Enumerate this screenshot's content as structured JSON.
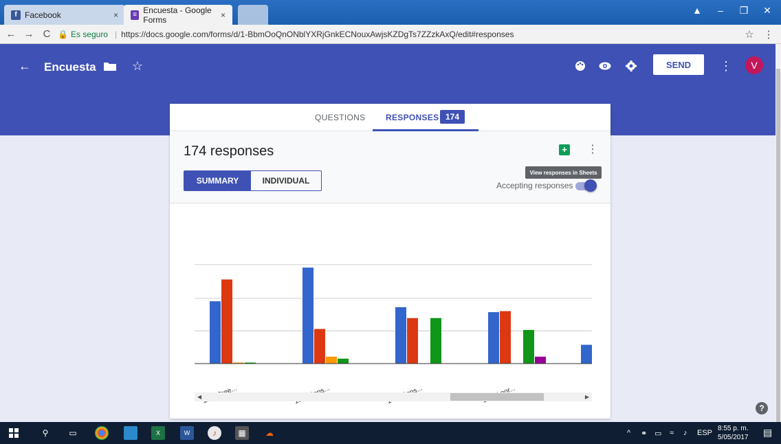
{
  "browser": {
    "tabs": [
      {
        "title": "Facebook",
        "close": "×"
      },
      {
        "title": "Encuesta - Google Forms",
        "close": "×"
      }
    ],
    "secure_label": "Es seguro",
    "url": "https://docs.google.com/forms/d/1-BbmOoQnONblYXRjGnkECNouxAwjsKZDgTs7ZZzkAxQ/edit#responses"
  },
  "form": {
    "title": "Encuesta",
    "send_label": "SEND",
    "avatar_letter": "V",
    "accent_color": "#3f51b5"
  },
  "tabs": {
    "questions": "QUESTIONS",
    "responses": "RESPONSES",
    "responses_count": "174"
  },
  "responses": {
    "title": "174 responses",
    "summary_label": "SUMMARY",
    "individual_label": "INDIVIDUAL",
    "tooltip": "View responses in Sheets",
    "accepting_label": "Accepting responses",
    "accepting": true
  },
  "chart_data": {
    "type": "bar",
    "categories": [
      "12. ¿Cree...",
      "13. ¿Cons...",
      "14. ¿Cons...",
      "15. Si por...",
      "16. ¿"
    ],
    "series": [
      {
        "color": "#3366cc",
        "values": [
          63,
          97,
          57,
          52,
          19
        ]
      },
      {
        "color": "#dc3912",
        "values": [
          85,
          35,
          46,
          53,
          null
        ]
      },
      {
        "color": "#ff9900",
        "values": [
          1,
          7,
          0,
          0,
          null
        ]
      },
      {
        "color": "#109618",
        "values": [
          1,
          5,
          46,
          34,
          null
        ]
      },
      {
        "color": "#990099",
        "values": [
          0,
          0,
          0,
          7,
          null
        ]
      }
    ],
    "ylim": [
      0,
      100
    ],
    "grid": true
  },
  "taskbar": {
    "language": "ESP",
    "time": "8:55 p. m.",
    "date": "5/05/2017"
  }
}
